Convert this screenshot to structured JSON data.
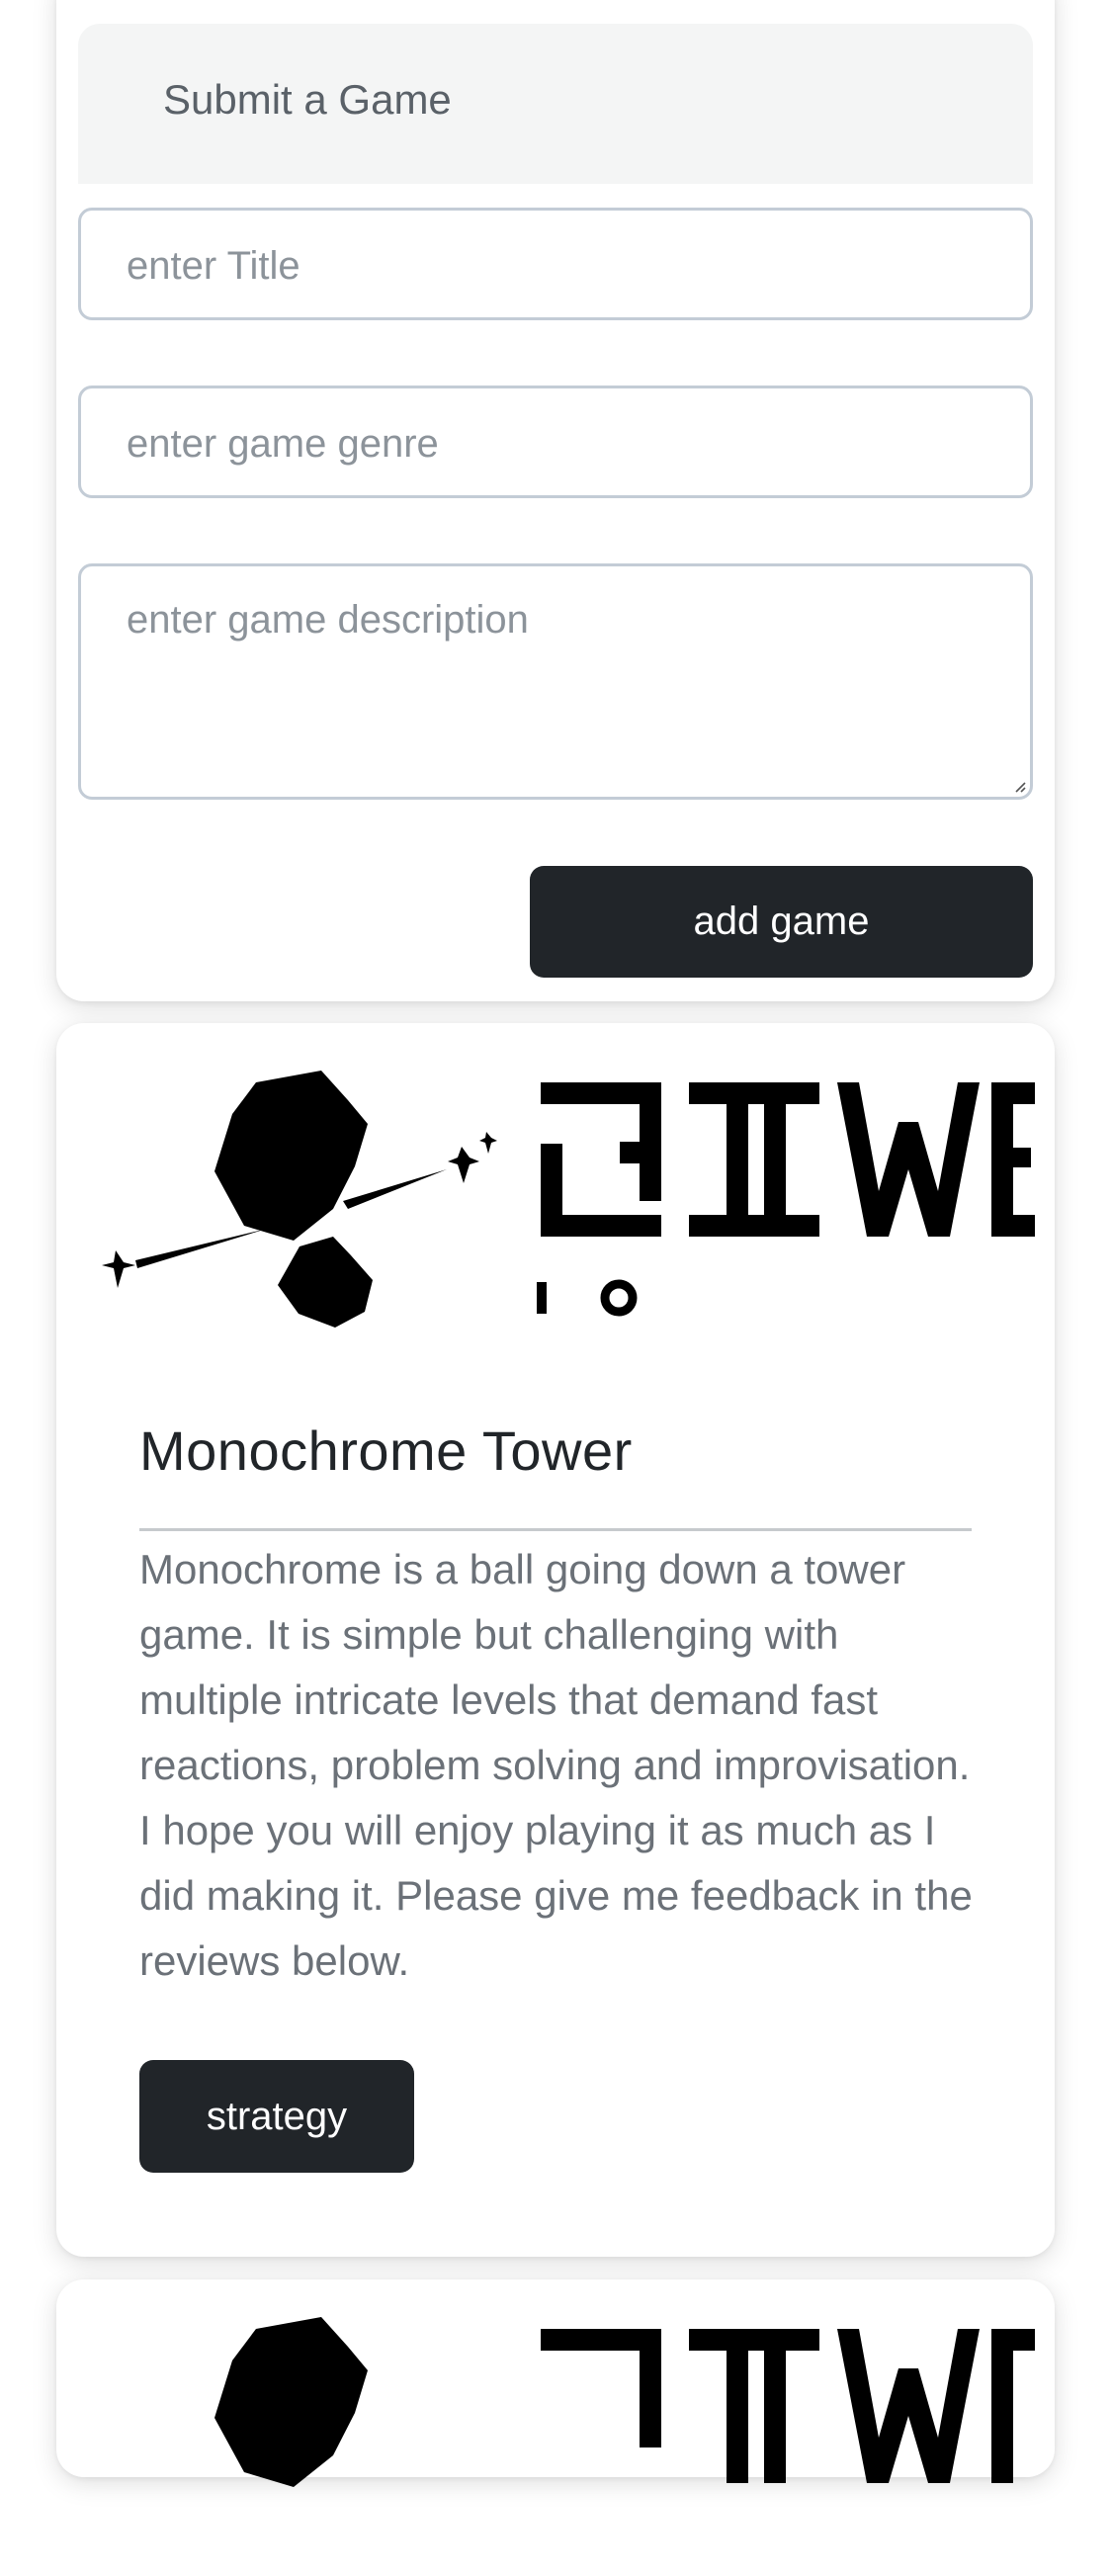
{
  "form": {
    "header": "Submit a Game",
    "title_placeholder": "enter Title",
    "genre_placeholder": "enter game genre",
    "description_placeholder": "enter game description",
    "submit_label": "add game"
  },
  "games": [
    {
      "logo_text": "GIWE io",
      "title": "Monochrome Tower",
      "description": "Monochrome is a ball going down a tower game. It is simple but challenging with multiple intricate levels that demand fast reactions, problem solving and improvisation. I hope you will enjoy playing it as much as I did making it. Please give me feedback in the reviews below.",
      "genre": "strategy"
    },
    {
      "logo_text": "GIWE io"
    }
  ],
  "colors": {
    "dark_button": "#212529",
    "field_border": "#c3ccd6",
    "header_bg": "#f4f5f5"
  }
}
